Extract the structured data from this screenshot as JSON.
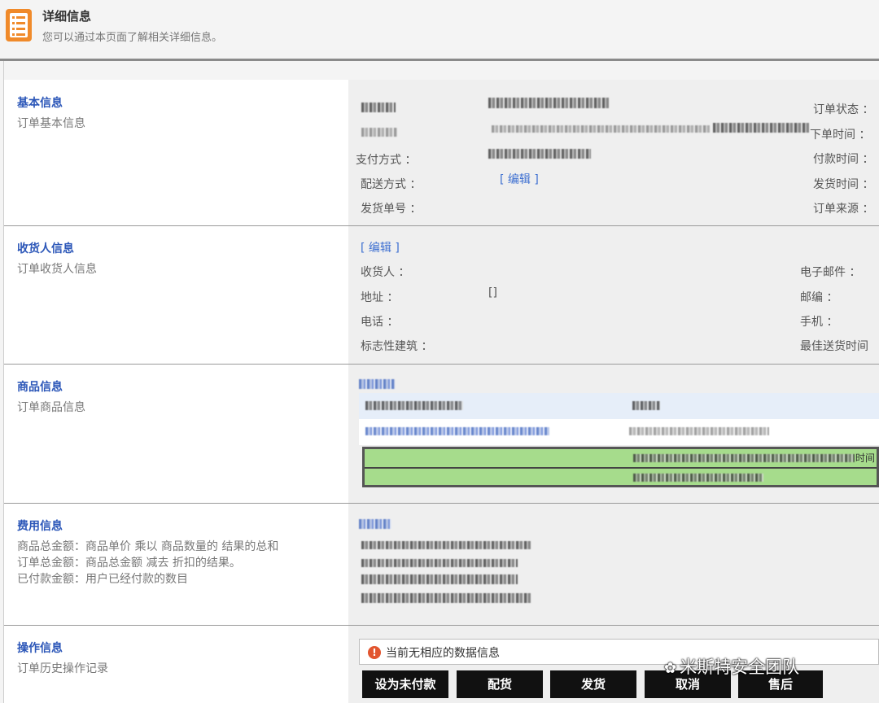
{
  "header": {
    "title": "详细信息",
    "subtitle": "您可以通过本页面了解相关详细信息。",
    "icon": "list-document-icon",
    "icon_color": "#f08a2a"
  },
  "sections": {
    "basic": {
      "title": "基本信息",
      "desc": "订单基本信息",
      "left_labels": [
        "支付方式 ：",
        "配送方式 ：",
        "发货单号 ："
      ],
      "edit_label": "[ 编辑 ]",
      "right_labels": [
        "订单状态 ：",
        "下单时间 ：",
        "付款时间 ：",
        "发货时间 ：",
        "订单来源 ："
      ]
    },
    "consignee": {
      "title": "收货人信息",
      "desc": "订单收货人信息",
      "edit_label": "[ 编辑 ]",
      "left_labels": [
        "收货人 ：",
        "地址 ：",
        "电话 ：",
        "标志性建筑 ："
      ],
      "address_value": "[]",
      "right_labels": [
        "电子邮件 ：",
        "邮编 ：",
        "手机 ：",
        "最佳送货时间"
      ]
    },
    "goods": {
      "title": "商品信息",
      "desc": "订单商品信息",
      "green_tail": "时间"
    },
    "fees": {
      "title": "费用信息",
      "desc": [
        "商品总金额：商品单价 乘以 商品数量的 结果的总和",
        "订单总金额：商品总金额 减去 折扣的结果。",
        "已付款金额：用户已经付款的数目"
      ]
    },
    "operation": {
      "title": "操作信息",
      "desc": "订单历史操作记录",
      "alert_text": "当前无相应的数据信息",
      "alert_icon": "warning-icon",
      "buttons": [
        "设为未付款",
        "配货",
        "发货",
        "取消",
        "售后"
      ]
    }
  },
  "watermark": {
    "text": "米斯特安全团队",
    "icon": "wechat-icon"
  },
  "colors": {
    "section_title": "#2b56b8",
    "link": "#3d6fd1",
    "button_bg": "#111111",
    "goods_highlight": "#a6dc8c"
  }
}
